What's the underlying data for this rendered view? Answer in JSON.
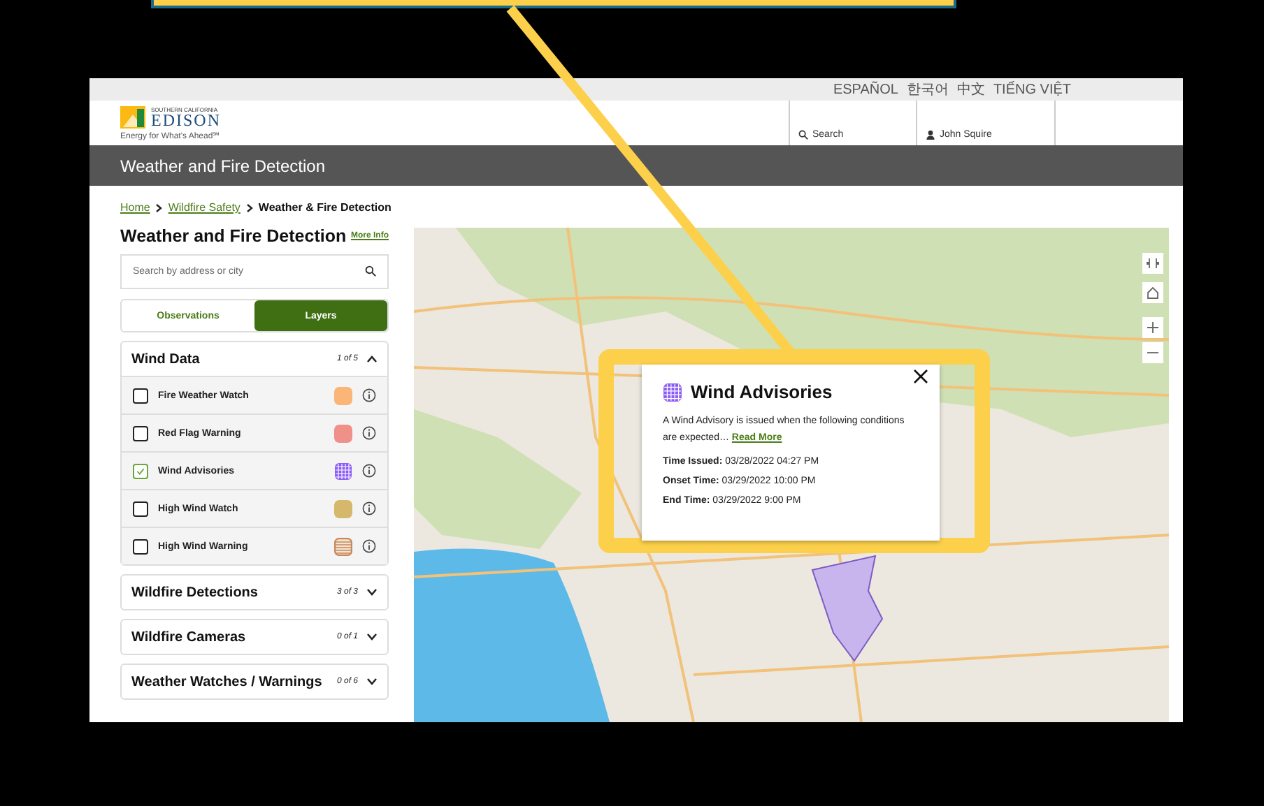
{
  "languages": [
    "ESPAÑOL",
    "한국어",
    "中文",
    "TIẾNG VIỆT"
  ],
  "header": {
    "logo_top": "SOUTHERN CALIFORNIA",
    "logo_name": "EDISON",
    "tagline": "Energy for What's Ahead℠",
    "search": "Search",
    "user": "John Squire"
  },
  "title_bar": "Weather and Fire Detection",
  "breadcrumb": [
    {
      "label": "Home",
      "link": true
    },
    {
      "label": "Wildfire Safety",
      "link": true
    },
    {
      "label": "Weather & Fire Detection",
      "link": false
    }
  ],
  "sidebar": {
    "heading": "Weather and Fire Detection",
    "more_info": "More Info",
    "search": {
      "placeholder": "Search by address or city"
    },
    "tabs": [
      {
        "label": "Observations",
        "selected": false
      },
      {
        "label": "Layers",
        "selected": true
      }
    ],
    "sections": [
      {
        "title": "Wind Data",
        "count": "1 of 5",
        "expanded": true,
        "items": [
          {
            "label": "Fire Weather Watch",
            "checked": false,
            "color": "#fbb577",
            "kind": "solid"
          },
          {
            "label": "Red Flag Warning",
            "checked": false,
            "color": "#ef9089",
            "kind": "solid"
          },
          {
            "label": "Wind Advisories",
            "checked": true,
            "color": "#8b5cf6",
            "kind": "grid"
          },
          {
            "label": "High Wind Watch",
            "checked": false,
            "color": "#d6b86d",
            "kind": "solid"
          },
          {
            "label": "High Wind Warning",
            "checked": false,
            "color": "#c9885a",
            "kind": "stripes"
          }
        ]
      },
      {
        "title": "Wildfire Detections",
        "count": "3 of 3",
        "expanded": false
      },
      {
        "title": "Wildfire Cameras",
        "count": "0 of 1",
        "expanded": false
      },
      {
        "title": "Weather Watches / Warnings",
        "count": "0 of 6",
        "expanded": false
      }
    ]
  },
  "popup": {
    "title": "Wind Advisories",
    "color": "#8b5cf6",
    "text": "A Wind Advisory is issued when the following conditions are expected…",
    "link": "Read More",
    "fields": [
      {
        "label": "Time Issued:",
        "value": "03/28/2022 04:27 PM"
      },
      {
        "label": "Onset Time:",
        "value": "03/29/2022 10:00 PM"
      },
      {
        "label": "End Time:",
        "value": "03/29/2022 9:00 PM"
      }
    ]
  }
}
